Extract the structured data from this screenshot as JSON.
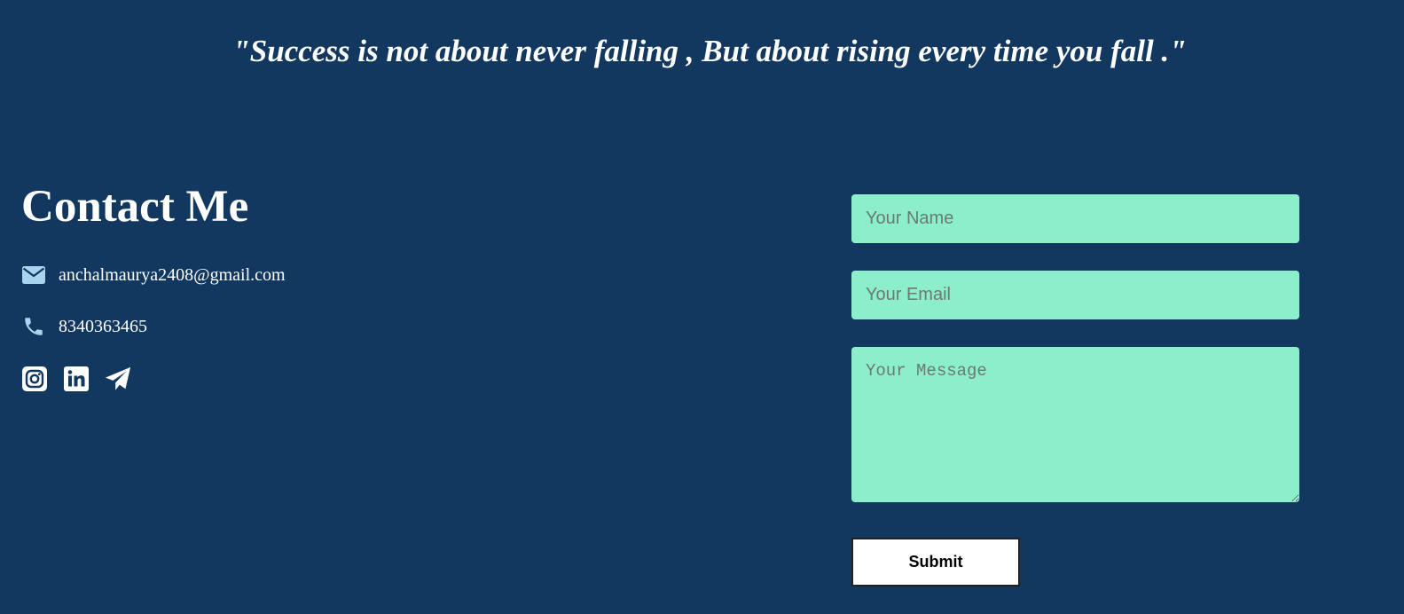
{
  "quote": "\"Success is not about never falling , But about rising every time you fall .\"",
  "contact": {
    "title": "Contact Me",
    "email": "anchalmaurya2408@gmail.com",
    "phone": "8340363465",
    "icons": {
      "email": "envelope-icon",
      "phone": "phone-icon"
    },
    "socials": [
      "instagram-icon",
      "linkedin-icon",
      "telegram-icon"
    ]
  },
  "form": {
    "name_placeholder": "Your Name",
    "email_placeholder": "Your Email",
    "message_placeholder": "Your Message",
    "submit_label": "Submit"
  },
  "colors": {
    "background": "#13385f",
    "field_background": "#8ceecb",
    "icon_accent": "#a8d4f0",
    "text": "#ffffff"
  }
}
